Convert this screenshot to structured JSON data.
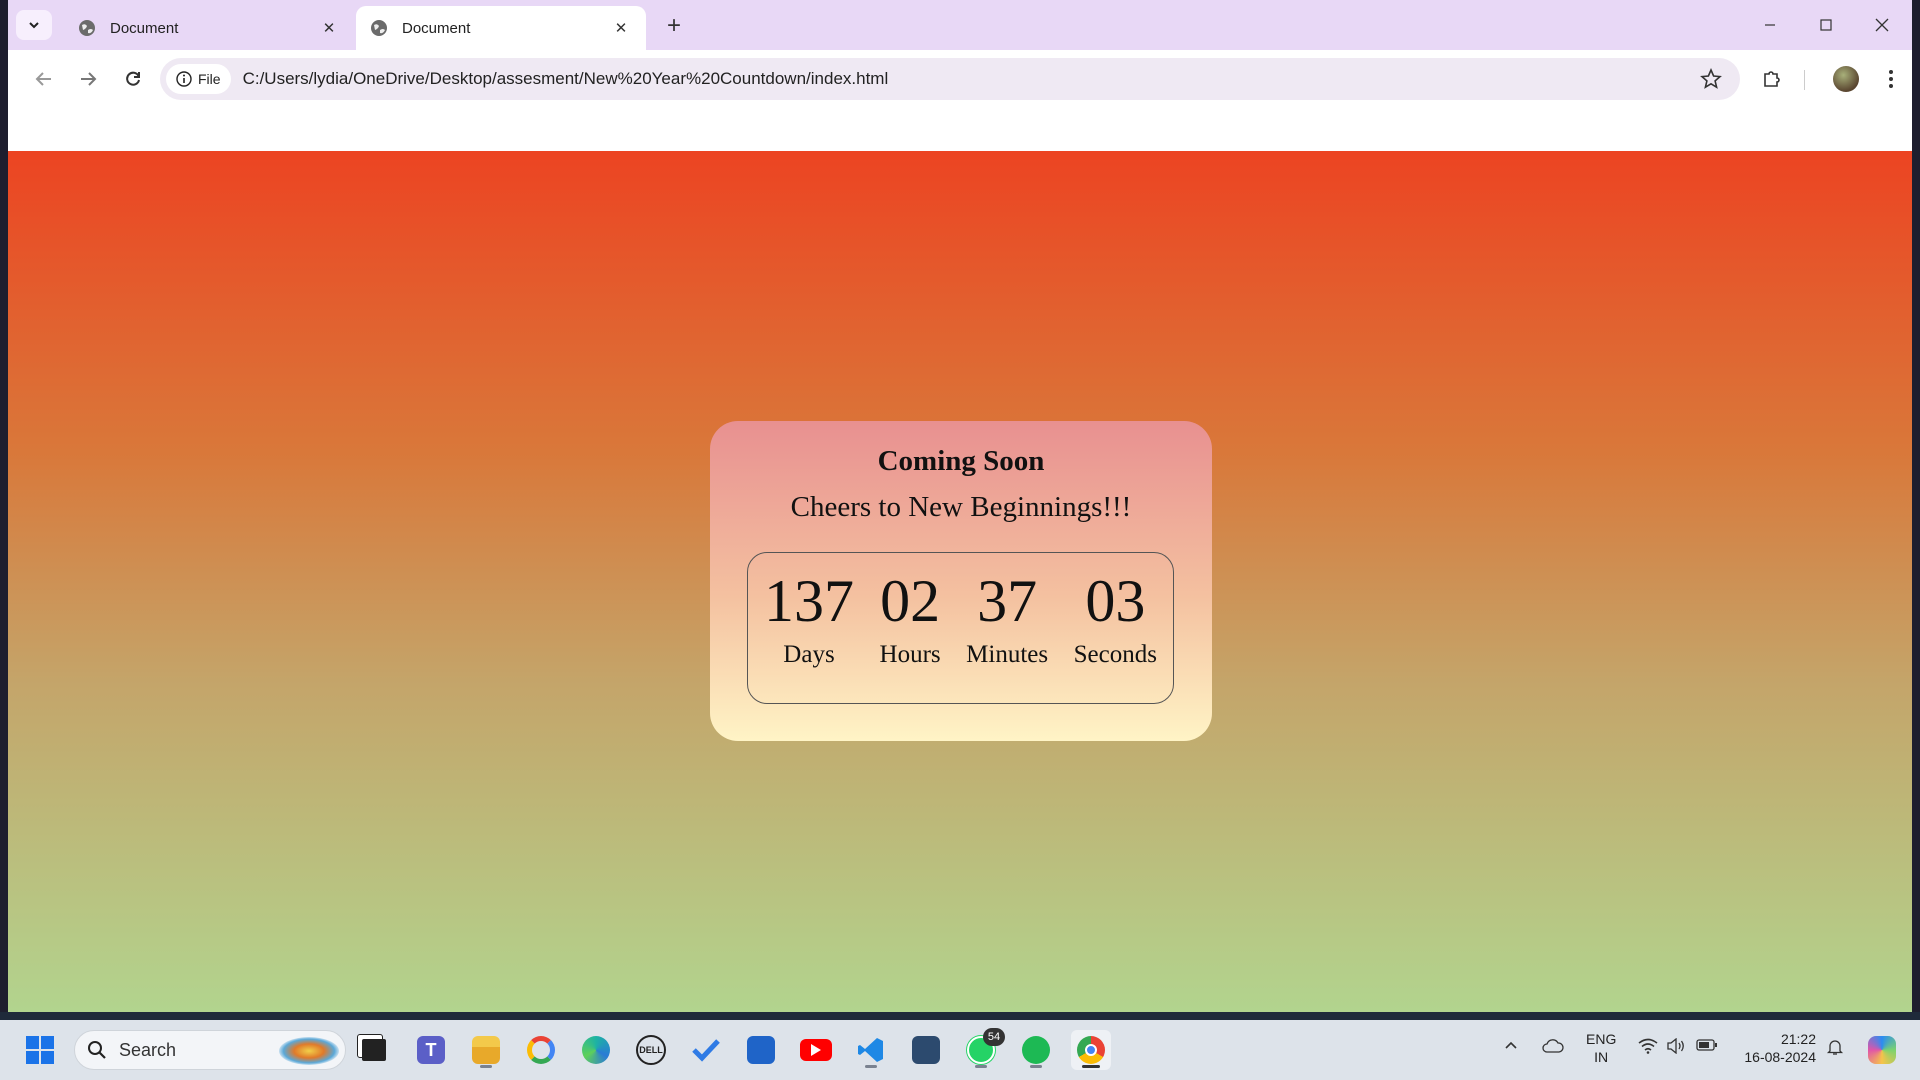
{
  "browser": {
    "tabs": [
      {
        "title": "Document",
        "active": false
      },
      {
        "title": "Document",
        "active": true
      }
    ],
    "omnibox": {
      "chip_label": "File",
      "url": "C:/Users/lydia/OneDrive/Desktop/assesment/New%20Year%20Countdown/index.html"
    }
  },
  "page": {
    "title": "Coming Soon",
    "subtitle": "Cheers to New Beginnings!!!",
    "countdown": [
      {
        "value": "137",
        "label": "Days"
      },
      {
        "value": "02",
        "label": "Hours"
      },
      {
        "value": "37",
        "label": "Minutes"
      },
      {
        "value": "03",
        "label": "Seconds"
      }
    ],
    "colors": {
      "gradient_top": "#ec4422",
      "gradient_bottom": "#b2d48e"
    }
  },
  "taskbar": {
    "search_placeholder": "Search",
    "whatsapp_badge": "54",
    "language": "ENG",
    "region": "IN",
    "time": "21:22",
    "date": "16-08-2024",
    "apps": [
      "start-icon",
      "search-icon",
      "file-manager-icon",
      "teams-icon",
      "file-explorer-icon",
      "google-icon",
      "edge-icon",
      "dell-icon",
      "todo-icon",
      "store-icon",
      "youtube-icon",
      "vscode-icon",
      "mysql-workbench-icon",
      "whatsapp-icon",
      "spotify-icon",
      "chrome-icon"
    ]
  }
}
